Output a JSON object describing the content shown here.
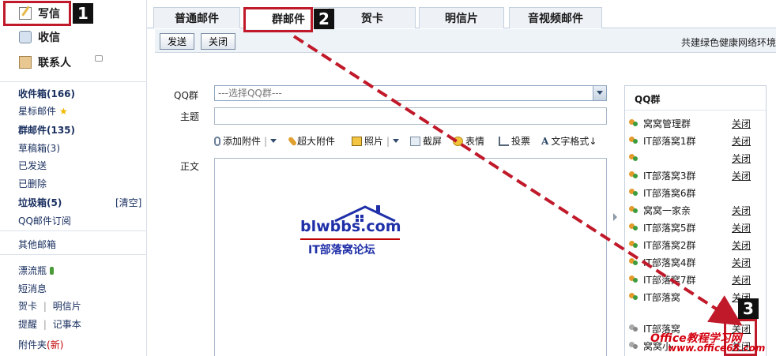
{
  "sidebar": {
    "write": "写信",
    "inbox": "收信",
    "contacts": "联系人",
    "folders": [
      {
        "label": "收件箱(166)",
        "bold": true
      },
      {
        "label": "星标邮件",
        "bold": false
      },
      {
        "label": "群邮件(135)",
        "bold": true
      },
      {
        "label": "草稿箱(3)",
        "bold": false
      },
      {
        "label": "已发送",
        "bold": false
      },
      {
        "label": "已删除",
        "bold": false
      },
      {
        "label": "垃圾箱(5)",
        "bold": true
      },
      {
        "label": "QQ邮件订阅",
        "bold": false
      }
    ],
    "clear": "[清空]",
    "other_mailbox": "其他邮箱",
    "drift_bottle": "漂流瓶",
    "sms": "短消息",
    "greeting_card": "贺卡",
    "postcard": "明信片",
    "reminder": "提醒",
    "notebook": "记事本",
    "attachment_folder": "附件夹",
    "new_tag": "(新)",
    "divider": "|"
  },
  "tabs": [
    "普通邮件",
    "群邮件",
    "贺卡",
    "明信片",
    "音视频邮件"
  ],
  "active_tab": 1,
  "toolbar": {
    "send": "发送",
    "close": "关闭",
    "slogan": "共建绿色健康网络环境"
  },
  "compose": {
    "qq_group_label": "QQ群",
    "qq_group_placeholder": "---选择QQ群---",
    "subject_label": "主题",
    "body_label": "正文",
    "add_attachment": "添加附件",
    "large_attachment": "超大附件",
    "photo": "照片",
    "screenshot": "截屏",
    "emoticon": "表情",
    "vote": "投票",
    "text_format": "文字格式↓"
  },
  "logo": {
    "main": "blwbbs.com",
    "sub": "IT部落窝论坛"
  },
  "qq_panel": {
    "title": "QQ群",
    "close_label": "关闭",
    "groups": [
      {
        "name": "窝窝管理群",
        "closable": true,
        "grey": false
      },
      {
        "name": "IT部落窝1群",
        "closable": true,
        "grey": false
      },
      {
        "name": "",
        "closable": true,
        "grey": false
      },
      {
        "name": "IT部落窝3群",
        "closable": true,
        "grey": false
      },
      {
        "name": "IT部落窝6群",
        "closable": false,
        "grey": false
      },
      {
        "name": "窝窝一家亲",
        "closable": true,
        "grey": false
      },
      {
        "name": "IT部落窝5群",
        "closable": true,
        "grey": false
      },
      {
        "name": "IT部落窝2群",
        "closable": true,
        "grey": false
      },
      {
        "name": "IT部落窝4群",
        "closable": true,
        "grey": false
      },
      {
        "name": "IT部落窝7群",
        "closable": true,
        "grey": false
      },
      {
        "name": "IT部落窝",
        "closable": true,
        "grey": false
      },
      {
        "name": "IT部落窝",
        "closable": true,
        "grey": true
      },
      {
        "name": "窝窝小",
        "closable": true,
        "grey": true
      }
    ]
  },
  "annotations": [
    "1",
    "2",
    "3"
  ],
  "watermark": {
    "line1": "Office教程学习网",
    "line2": "www.office68.com"
  },
  "colors": {
    "accent_red": "#c0192a",
    "link_blue": "#1a3060",
    "logo_blue": "#1f2fa8"
  }
}
